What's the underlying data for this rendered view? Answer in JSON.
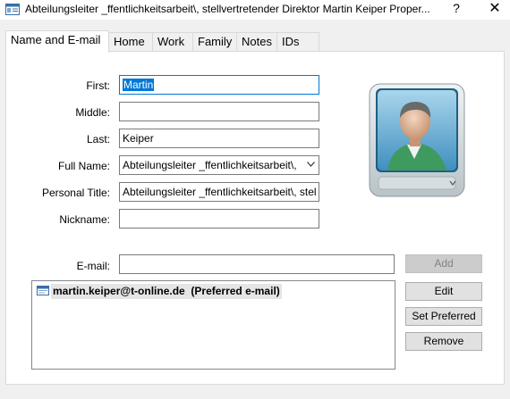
{
  "window": {
    "title": "Abteilungsleiter _ffentlichkeitsarbeit\\, stellvertretender Direktor Martin  Keiper Proper...",
    "help_label": "?",
    "close_label": "✕"
  },
  "tabs": [
    {
      "label": "Name and E-mail",
      "active": true
    },
    {
      "label": "Home",
      "active": false
    },
    {
      "label": "Work",
      "active": false
    },
    {
      "label": "Family",
      "active": false
    },
    {
      "label": "Notes",
      "active": false
    },
    {
      "label": "IDs",
      "active": false
    }
  ],
  "form": {
    "first": {
      "label": "First:",
      "value": "Martin"
    },
    "middle": {
      "label": "Middle:",
      "value": ""
    },
    "last": {
      "label": "Last:",
      "value": "Keiper"
    },
    "full_name": {
      "label": "Full Name:",
      "value": "Abteilungsleiter _ffentlichkeitsarbeit\\,"
    },
    "personal_title": {
      "label": "Personal Title:",
      "value": "Abteilungsleiter _ffentlichkeitsarbeit\\, stel"
    },
    "nickname": {
      "label": "Nickname:",
      "value": ""
    }
  },
  "email": {
    "label": "E-mail:",
    "value": "",
    "list": [
      {
        "address": "martin.keiper@t-online.de",
        "tag": "  (Preferred e-mail)"
      }
    ]
  },
  "buttons": {
    "add": "Add",
    "edit": "Edit",
    "set_preferred": "Set Preferred",
    "remove": "Remove"
  },
  "photo_icon": "contact-photo-icon",
  "colors": {
    "accent": "#0078d7",
    "panel": "#ffffff",
    "dialog_bg": "#f0f0f0"
  }
}
